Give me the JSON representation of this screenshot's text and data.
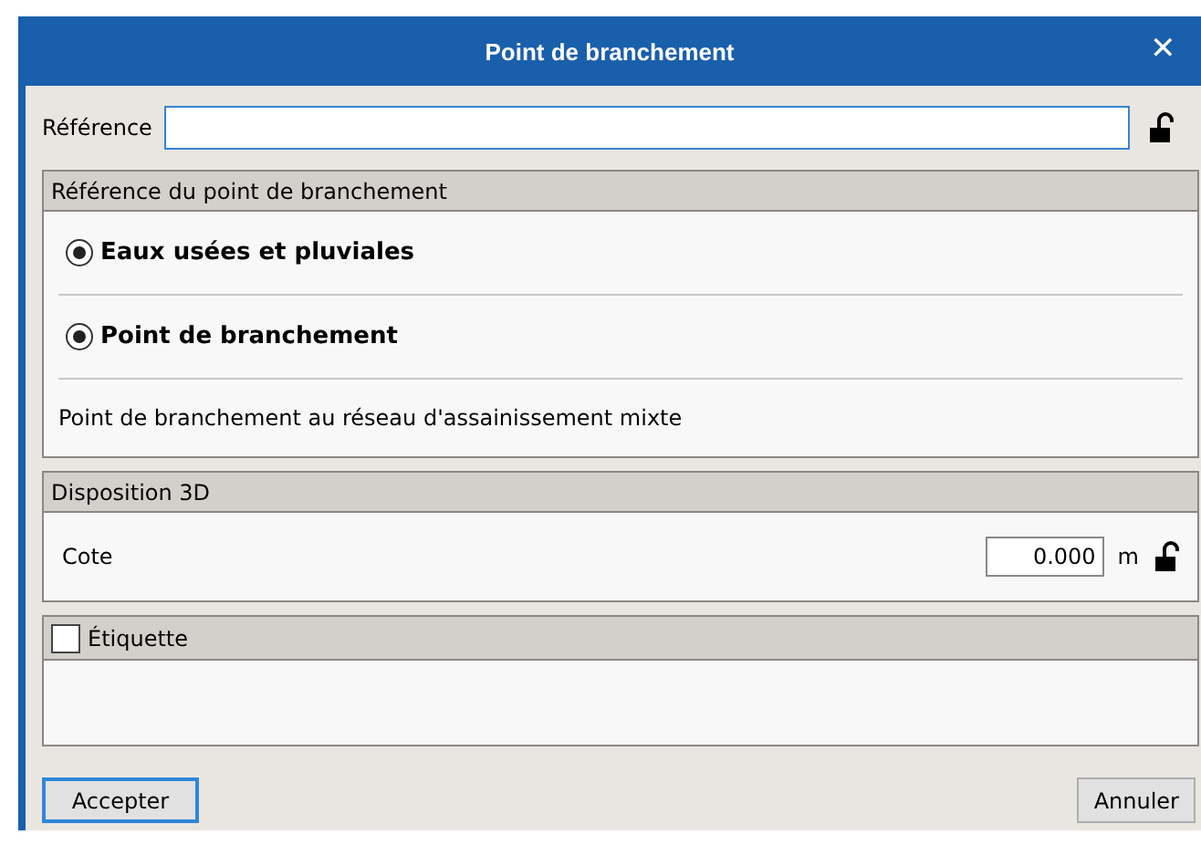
{
  "window": {
    "title": "Point de branchement",
    "close": "✕"
  },
  "reference": {
    "label": "Référence"
  },
  "group_reference": {
    "title": "Référence du point de branchement",
    "options": [
      {
        "label": "Eaux usées et pluviales",
        "selected": true
      },
      {
        "label": "Point de branchement",
        "selected": true
      }
    ],
    "description": "Point de branchement au réseau d'assainissement mixte"
  },
  "group_3d": {
    "title": "Disposition 3D",
    "label": "Cote",
    "value": "0.000",
    "unit": "m"
  },
  "group_label": {
    "title": "Étiquette",
    "checked": false
  },
  "buttons": [
    {
      "label": "Accepter",
      "default": true
    },
    {
      "label": "Annuler",
      "default": false
    }
  ]
}
